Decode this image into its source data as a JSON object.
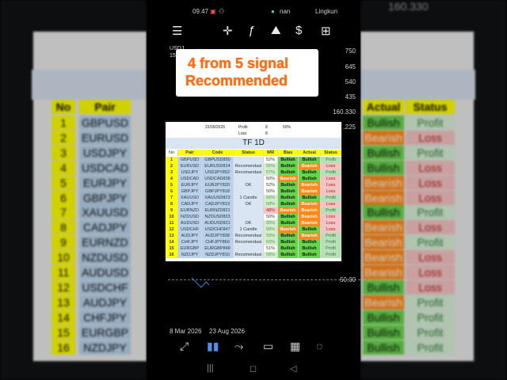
{
  "status_bar": {
    "time": "09.47",
    "carrier": "nan",
    "location": "Lingkun"
  },
  "toolbar": {
    "icons": [
      "menu-icon",
      "crosshair-icon",
      "function-icon",
      "objects-icon",
      "dollar-icon",
      "new-order-icon"
    ]
  },
  "signal": {
    "line1": "4 from 5 signal",
    "line2": "Recommended"
  },
  "chart": {
    "symbol": "USDJ",
    "price": "156.",
    "price_labels": [
      "750",
      "645",
      "540",
      "435",
      "160.330",
      "159.225"
    ],
    "indicator_level": "50.00",
    "dates": [
      "8 Mar 2026",
      "23 Aug 2026"
    ]
  },
  "table": {
    "date": "22/09/2026",
    "profit_label": "Profit",
    "profit": "8",
    "profit_pct": "50%",
    "loss_label": "Loss",
    "loss": "8",
    "timeframe": "TF 1D",
    "headers": [
      "No",
      "Pair",
      "Code",
      "Status",
      "WR",
      "Bias",
      "Actual",
      "Status"
    ],
    "rows": [
      {
        "no": "1",
        "pair": "GBPUSD",
        "code": "GBPUSD850",
        "status": "",
        "wr": "52%",
        "bias": "Bullish",
        "actual": "Bullish",
        "result": "Profit"
      },
      {
        "no": "2",
        "pair": "EURUSD",
        "code": "EURUSD814",
        "status": "Recomendasi",
        "wr": "56%",
        "bias": "Bullish",
        "actual": "Bearish",
        "result": "Loss"
      },
      {
        "no": "3",
        "pair": "USDJPY",
        "code": "USDJPY852",
        "status": "Recomendasi",
        "wr": "57%",
        "bias": "Bullish",
        "actual": "Bullish",
        "result": "Profit"
      },
      {
        "no": "4",
        "pair": "USDCAD",
        "code": "USDCAD836",
        "status": "",
        "wr": "50%",
        "bias": "Bearish",
        "actual": "Bullish",
        "result": "Loss"
      },
      {
        "no": "5",
        "pair": "EURJPY",
        "code": "EURJPY820",
        "status": "OK",
        "wr": "52%",
        "bias": "Bullish",
        "actual": "Bearish",
        "result": "Loss"
      },
      {
        "no": "6",
        "pair": "GBPJPY",
        "code": "GBPJPY818",
        "status": "",
        "wr": "50%",
        "bias": "Bullish",
        "actual": "Bearish",
        "result": "Loss"
      },
      {
        "no": "7",
        "pair": "XAUUSD",
        "code": "XAUUSD823",
        "status": "1 Candle",
        "wr": "56%",
        "bias": "Bullish",
        "actual": "Bullish",
        "result": "Profit"
      },
      {
        "no": "8",
        "pair": "CADJPY",
        "code": "CADJPY813",
        "status": "OK",
        "wr": "58%",
        "bias": "Bullish",
        "actual": "Bearish",
        "result": "Loss"
      },
      {
        "no": "9",
        "pair": "EURNZD",
        "code": "EURNZD821",
        "status": "",
        "wr": "48%",
        "bias": "Bearish",
        "actual": "Bearish",
        "result": "Profit"
      },
      {
        "no": "10",
        "pair": "NZDUSD",
        "code": "NZDUSD833",
        "status": "",
        "wr": "50%",
        "bias": "Bullish",
        "actual": "Bearish",
        "result": "Loss"
      },
      {
        "no": "11",
        "pair": "AUDUSD",
        "code": "AUDUSD821",
        "status": "OK",
        "wr": "55%",
        "bias": "Bullish",
        "actual": "Bearish",
        "result": "Loss"
      },
      {
        "no": "12",
        "pair": "USDCHF",
        "code": "USDCHF847",
        "status": "1 Candle",
        "wr": "58%",
        "bias": "Bearish",
        "actual": "Bullish",
        "result": "Loss"
      },
      {
        "no": "13",
        "pair": "AUDJPY",
        "code": "AUDJPY838",
        "status": "Recomendasi",
        "wr": "59%",
        "bias": "Bullish",
        "actual": "Bearish",
        "result": "Profit"
      },
      {
        "no": "14",
        "pair": "CHFJPY",
        "code": "CHFJPY860",
        "status": "Recomendasi",
        "wr": "63%",
        "bias": "Bullish",
        "actual": "Bullish",
        "result": "Profit"
      },
      {
        "no": "15",
        "pair": "EURGBP",
        "code": "EURGBP849",
        "status": "",
        "wr": "51%",
        "bias": "Bullish",
        "actual": "Bullish",
        "result": "Profit"
      },
      {
        "no": "16",
        "pair": "NZDJPY",
        "code": "NZDJPY810",
        "status": "Recomendasi",
        "wr": "58%",
        "bias": "Bullish",
        "actual": "Bullish",
        "result": "Profit"
      }
    ]
  },
  "background": {
    "headers": [
      "No",
      "Pair",
      "Actual",
      "Status"
    ],
    "top_value": "160.330",
    "rows": [
      {
        "no": "1",
        "pair": "GBPUSD",
        "actual": "Bullish",
        "result": "Profit"
      },
      {
        "no": "2",
        "pair": "EURUSD",
        "actual": "Bearish",
        "result": "Loss"
      },
      {
        "no": "3",
        "pair": "USDJPY",
        "actual": "Bullish",
        "result": "Profit"
      },
      {
        "no": "4",
        "pair": "USDCAD",
        "actual": "Bullish",
        "result": "Loss"
      },
      {
        "no": "5",
        "pair": "EURJPY",
        "actual": "Bearish",
        "result": "Loss"
      },
      {
        "no": "6",
        "pair": "GBPJPY",
        "actual": "Bearish",
        "result": "Loss"
      },
      {
        "no": "7",
        "pair": "XAUUSD",
        "actual": "Bullish",
        "result": "Profit"
      },
      {
        "no": "8",
        "pair": "CADJPY",
        "actual": "Bearish",
        "result": "Loss"
      },
      {
        "no": "9",
        "pair": "EURNZD",
        "actual": "Bearish",
        "result": "Profit"
      },
      {
        "no": "10",
        "pair": "NZDUSD",
        "actual": "Bearish",
        "result": "Loss"
      },
      {
        "no": "11",
        "pair": "AUDUSD",
        "actual": "Bearish",
        "result": "Loss"
      },
      {
        "no": "12",
        "pair": "USDCHF",
        "actual": "Bullish",
        "result": "Loss"
      },
      {
        "no": "13",
        "pair": "AUDJPY",
        "actual": "Bearish",
        "result": "Profit"
      },
      {
        "no": "14",
        "pair": "CHFJPY",
        "actual": "Bullish",
        "result": "Profit"
      },
      {
        "no": "15",
        "pair": "EURGBP",
        "actual": "Bullish",
        "result": "Profit"
      },
      {
        "no": "16",
        "pair": "NZDJPY",
        "actual": "Bullish",
        "result": "Profit"
      }
    ]
  },
  "colors": {
    "accent": "#ff6a11",
    "bullish": "#68d44b",
    "bearish": "#ff8a1a",
    "profit_bg": "#b8e0b8",
    "loss_bg": "#f4c4c4",
    "header_blue": "#d9e5f2"
  },
  "navbar_icons": [
    "quotes-icon",
    "chart-icon",
    "trade-icon",
    "history-icon",
    "news-icon",
    "chat-icon"
  ],
  "system_nav": [
    "recent-apps-icon",
    "home-icon",
    "back-icon"
  ]
}
